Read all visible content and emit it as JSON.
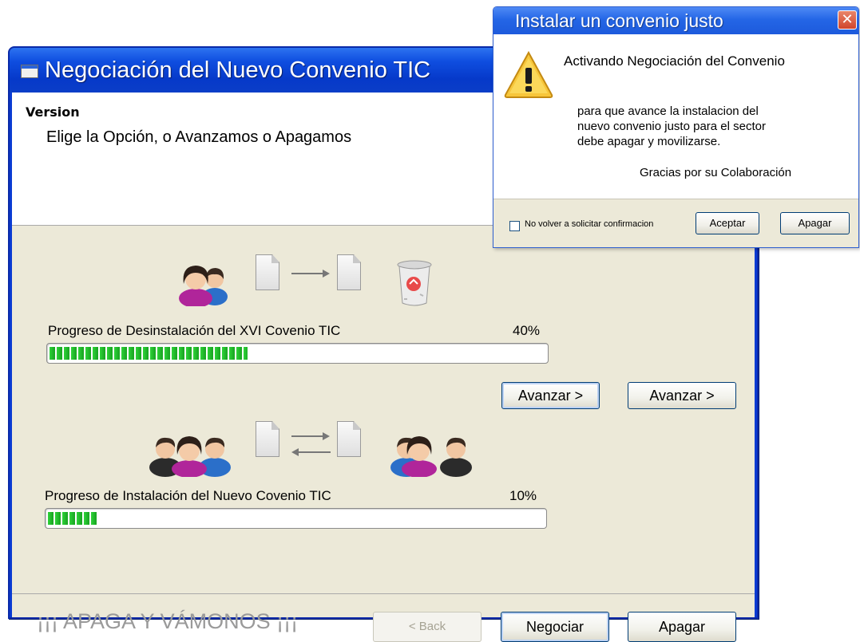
{
  "main_window": {
    "title": "Negociación del Nuevo Convenio TIC",
    "version_label": "Version",
    "instruction": "Elige la Opción, o Avanzamos o Apagamos",
    "uninstall": {
      "label": "Progreso de Desinstalación del XVI Covenio TIC",
      "percent_text": "40%",
      "progress": 0.4
    },
    "install": {
      "label": "Progreso de Instalación del Nuevo Covenio TIC",
      "percent_text": "10%",
      "progress": 0.1
    },
    "buttons": {
      "avanzar_1": "Avanzar >",
      "avanzar_2": "Avanzar >",
      "back": "< Back",
      "negociar": "Negociar",
      "apagar": "Apagar"
    },
    "slogan": "¡¡¡ APAGA Y VÁMONOS ¡¡¡"
  },
  "dialog": {
    "title": "Instalar un convenio justo",
    "close_glyph": "✕",
    "heading": "Activando Negociación del Convenio",
    "message_lines": [
      "para que avance la instalacion del",
      "nuevo convenio justo para el sector",
      "debe apagar y movilizarse."
    ],
    "thanks": "Gracias por su Colaboración",
    "checkbox_label": "No volver a solicitar confirmacion",
    "checkbox_checked": false,
    "buttons": {
      "aceptar": "Aceptar",
      "apagar": "Apagar"
    }
  },
  "colors": {
    "titlebar_blue": "#0639c9",
    "window_face": "#ece9d8",
    "progress_green": "#1aa823",
    "close_red": "#d0452c",
    "warning_yellow": "#f7c63b"
  },
  "icons": {
    "main_title": "window-icon",
    "users_pair": "users-icon",
    "document": "document-icon",
    "recycle_bin": "recycle-bin-icon",
    "warning": "warning-icon",
    "close": "close-icon"
  }
}
